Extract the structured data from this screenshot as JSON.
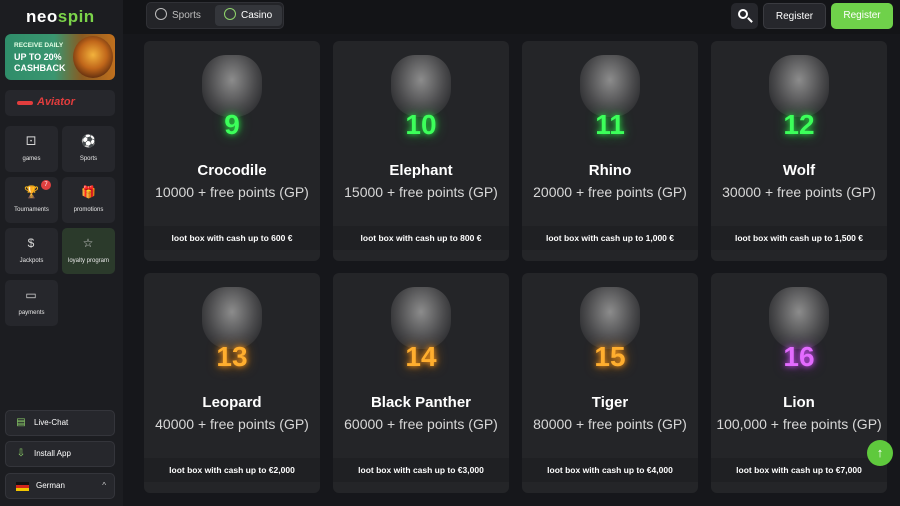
{
  "logo": {
    "part1": "neo",
    "part2": "spin"
  },
  "banner": {
    "line1": "RECEIVE DAILY",
    "line2": "UP TO 20%",
    "line3": "CASHBACK"
  },
  "aviator": {
    "label": "Aviator"
  },
  "sidebar": {
    "tiles": [
      {
        "label": "games",
        "icon": "dice-icon"
      },
      {
        "label": "Sports",
        "icon": "ball-icon"
      },
      {
        "label": "Tournaments",
        "icon": "trophy-icon",
        "badge": "7"
      },
      {
        "label": "promotions",
        "icon": "gift-icon"
      },
      {
        "label": "Jackpots",
        "icon": "money-bag-icon"
      },
      {
        "label": "loyalty program",
        "icon": "star-icon"
      },
      {
        "label": "payments",
        "icon": "cash-icon"
      }
    ],
    "livechat": "Live-Chat",
    "install": "Install App",
    "language": "German"
  },
  "topbar": {
    "tab_sports": "Sports",
    "tab_casino": "Casino",
    "login": "Register",
    "register": "Register"
  },
  "cards": [
    {
      "num": "9",
      "name": "Crocodile",
      "points": "10000 + free points (GP)",
      "loot": "loot box with cash up to 600 €",
      "color": "green"
    },
    {
      "num": "10",
      "name": "Elephant",
      "points": "15000 + free points (GP)",
      "loot": "loot box with cash up to 800 €",
      "color": "green"
    },
    {
      "num": "11",
      "name": "Rhino",
      "points": "20000 + free points (GP)",
      "loot": "loot box with cash up to 1,000 €",
      "color": "green"
    },
    {
      "num": "12",
      "name": "Wolf",
      "points": "30000 + free points (GP)",
      "loot": "loot box with cash up to 1,500 €",
      "color": "green"
    },
    {
      "num": "13",
      "name": "Leopard",
      "points": "40000 + free points (GP)",
      "loot": "loot box with cash up to €2,000",
      "color": "orange"
    },
    {
      "num": "14",
      "name": "Black Panther",
      "points": "60000 + free points (GP)",
      "loot": "loot box with cash up to €3,000",
      "color": "orange"
    },
    {
      "num": "15",
      "name": "Tiger",
      "points": "80000 + free points (GP)",
      "loot": "loot box with cash up to €4,000",
      "color": "orange"
    },
    {
      "num": "16",
      "name": "Lion",
      "points": "100,000 + free points (GP)",
      "loot": "loot box with cash up to €7,000",
      "color": "purple"
    }
  ],
  "fab": {
    "icon": "arrow-up-icon"
  }
}
